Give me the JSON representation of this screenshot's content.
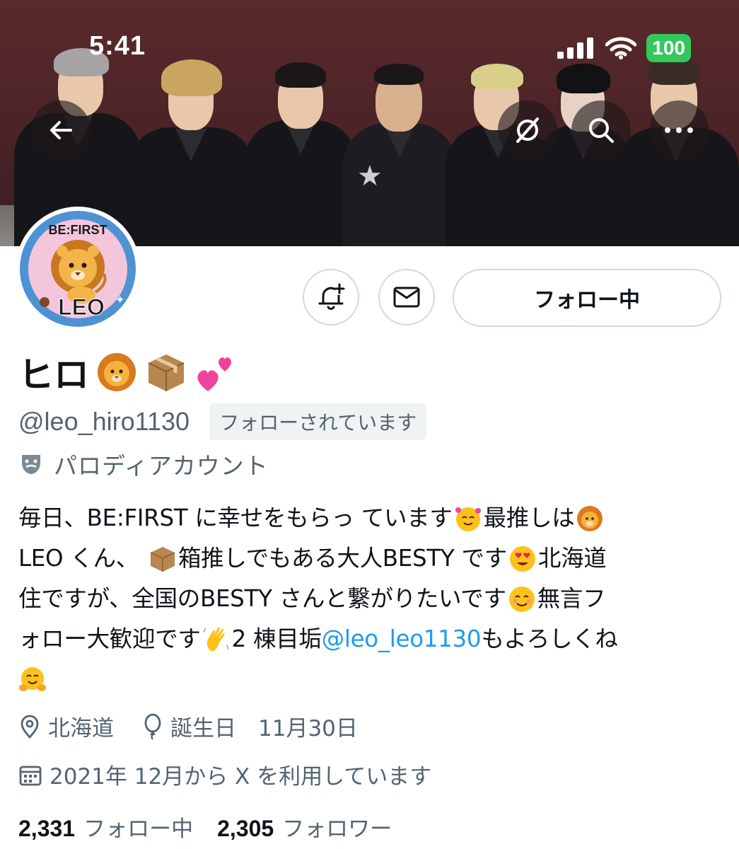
{
  "status_bar": {
    "time": "5:41",
    "battery": "100",
    "icons": [
      "cellular-signal-icon",
      "wifi-icon",
      "battery-icon"
    ]
  },
  "header": {
    "back_icon": "arrow-left-icon",
    "banner_icons": [
      "mute-icon",
      "search-icon",
      "more-icon"
    ]
  },
  "avatar": {
    "top_text": "BE:FIRST",
    "bottom_text": "LEO"
  },
  "actions": {
    "notify_icon": "bell-plus-icon",
    "message_icon": "mail-icon",
    "follow_label": "フォロー中"
  },
  "profile": {
    "name": "ヒロ",
    "name_emojis": [
      "lion-face-emoji",
      "package-emoji",
      "two-hearts-emoji"
    ],
    "handle": "@leo_hiro1130",
    "follows_you": "フォローされています",
    "parody_label": "パロディアカウント",
    "bio": {
      "l1a": "毎日、BE:FIRST に幸せをもらっ ています",
      "l1b": "最推しは",
      "l2a": "LEO くん、",
      "l2b": "箱推しでもある大人BESTY です",
      "l2c": " 北海道",
      "l3a": "住ですが、全国のBESTY さんと繋がりたいです",
      "l3b": "無言フ",
      "l4a": "ォロー大歓迎です",
      "l4b": "2 棟目垢 ",
      "l4link": "@leo_leo1130",
      "l4c": " もよろしくね"
    },
    "location": "北海道",
    "birthday": "誕生日　11月30日",
    "joined": "2021年 12月から X を利用しています"
  },
  "stats": {
    "following_count": "2,331",
    "following_label": "フォロー中",
    "followers_count": "2,305",
    "followers_label": "フォロワー"
  },
  "colors": {
    "accent_link": "#1d9bf0",
    "secondary_text": "#536471",
    "battery_green": "#32c85a",
    "border": "#cfd9de"
  }
}
